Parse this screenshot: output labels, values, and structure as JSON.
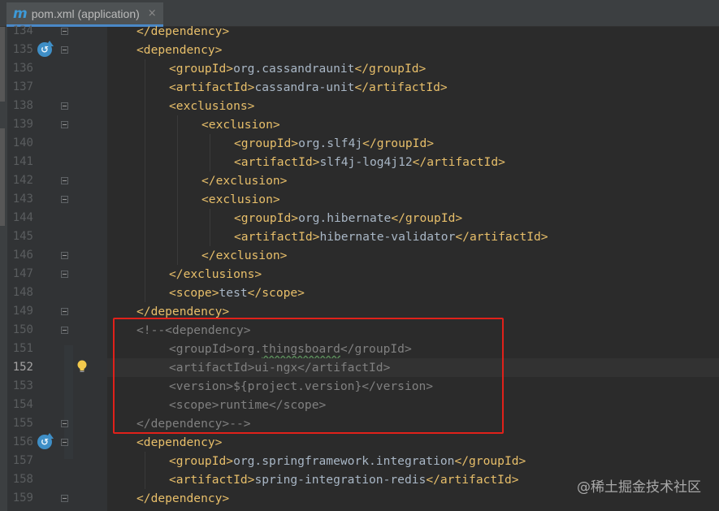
{
  "tab": {
    "icon": "maven-m-icon",
    "icon_glyph": "m",
    "label": "pom.xml (application)",
    "close_glyph": "×"
  },
  "colors": {
    "tag": "#e8bf6a",
    "text": "#a9b7c6",
    "comment": "#808080",
    "highlight_border": "#e0211a",
    "accent": "#4a88c7"
  },
  "lines": [
    {
      "no": "134",
      "text": "</dependency>",
      "kind": "tags"
    },
    {
      "no": "135",
      "text": "<dependency>",
      "kind": "tags",
      "gutter_icon": "override-icon"
    },
    {
      "no": "136",
      "text": "<groupId>org.cassandraunit</groupId>",
      "kind": "tags"
    },
    {
      "no": "137",
      "text": "<artifactId>cassandra-unit</artifactId>",
      "kind": "tags"
    },
    {
      "no": "138",
      "text": "<exclusions>",
      "kind": "tags"
    },
    {
      "no": "139",
      "text": "<exclusion>",
      "kind": "tags"
    },
    {
      "no": "140",
      "text": "<groupId>org.slf4j</groupId>",
      "kind": "tags"
    },
    {
      "no": "141",
      "text": "<artifactId>slf4j-log4j12</artifactId>",
      "kind": "tags"
    },
    {
      "no": "142",
      "text": "</exclusion>",
      "kind": "tags"
    },
    {
      "no": "143",
      "text": "<exclusion>",
      "kind": "tags"
    },
    {
      "no": "144",
      "text": "<groupId>org.hibernate</groupId>",
      "kind": "tags"
    },
    {
      "no": "145",
      "text": "<artifactId>hibernate-validator</artifactId>",
      "kind": "tags"
    },
    {
      "no": "146",
      "text": "</exclusion>",
      "kind": "tags"
    },
    {
      "no": "147",
      "text": "</exclusions>",
      "kind": "tags"
    },
    {
      "no": "148",
      "text": "<scope>test</scope>",
      "kind": "tags"
    },
    {
      "no": "149",
      "text": "</dependency>",
      "kind": "tags"
    },
    {
      "no": "150",
      "text": "<!--<dependency>",
      "kind": "comment"
    },
    {
      "no": "151",
      "text": "<groupId>org.thingsboard</groupId>",
      "kind": "comment",
      "wavy": "thingsboard"
    },
    {
      "no": "152",
      "text": "<artifactId>ui-ngx</artifactId>",
      "kind": "comment",
      "current": true,
      "gutter_icon": "lightbulb-icon"
    },
    {
      "no": "153",
      "text": "<version>${project.version}</version>",
      "kind": "comment"
    },
    {
      "no": "154",
      "text": "<scope>runtime</scope>",
      "kind": "comment"
    },
    {
      "no": "155",
      "text": "</dependency>-->",
      "kind": "comment"
    },
    {
      "no": "156",
      "text": "<dependency>",
      "kind": "tags",
      "gutter_icon": "override-icon"
    },
    {
      "no": "157",
      "text": "<groupId>org.springframework.integration</groupId>",
      "kind": "tags"
    },
    {
      "no": "158",
      "text": "<artifactId>spring-integration-redis</artifactId>",
      "kind": "tags"
    },
    {
      "no": "159",
      "text": "</dependency>",
      "kind": "tags"
    }
  ],
  "watermark": "@稀土掘金技术社区"
}
